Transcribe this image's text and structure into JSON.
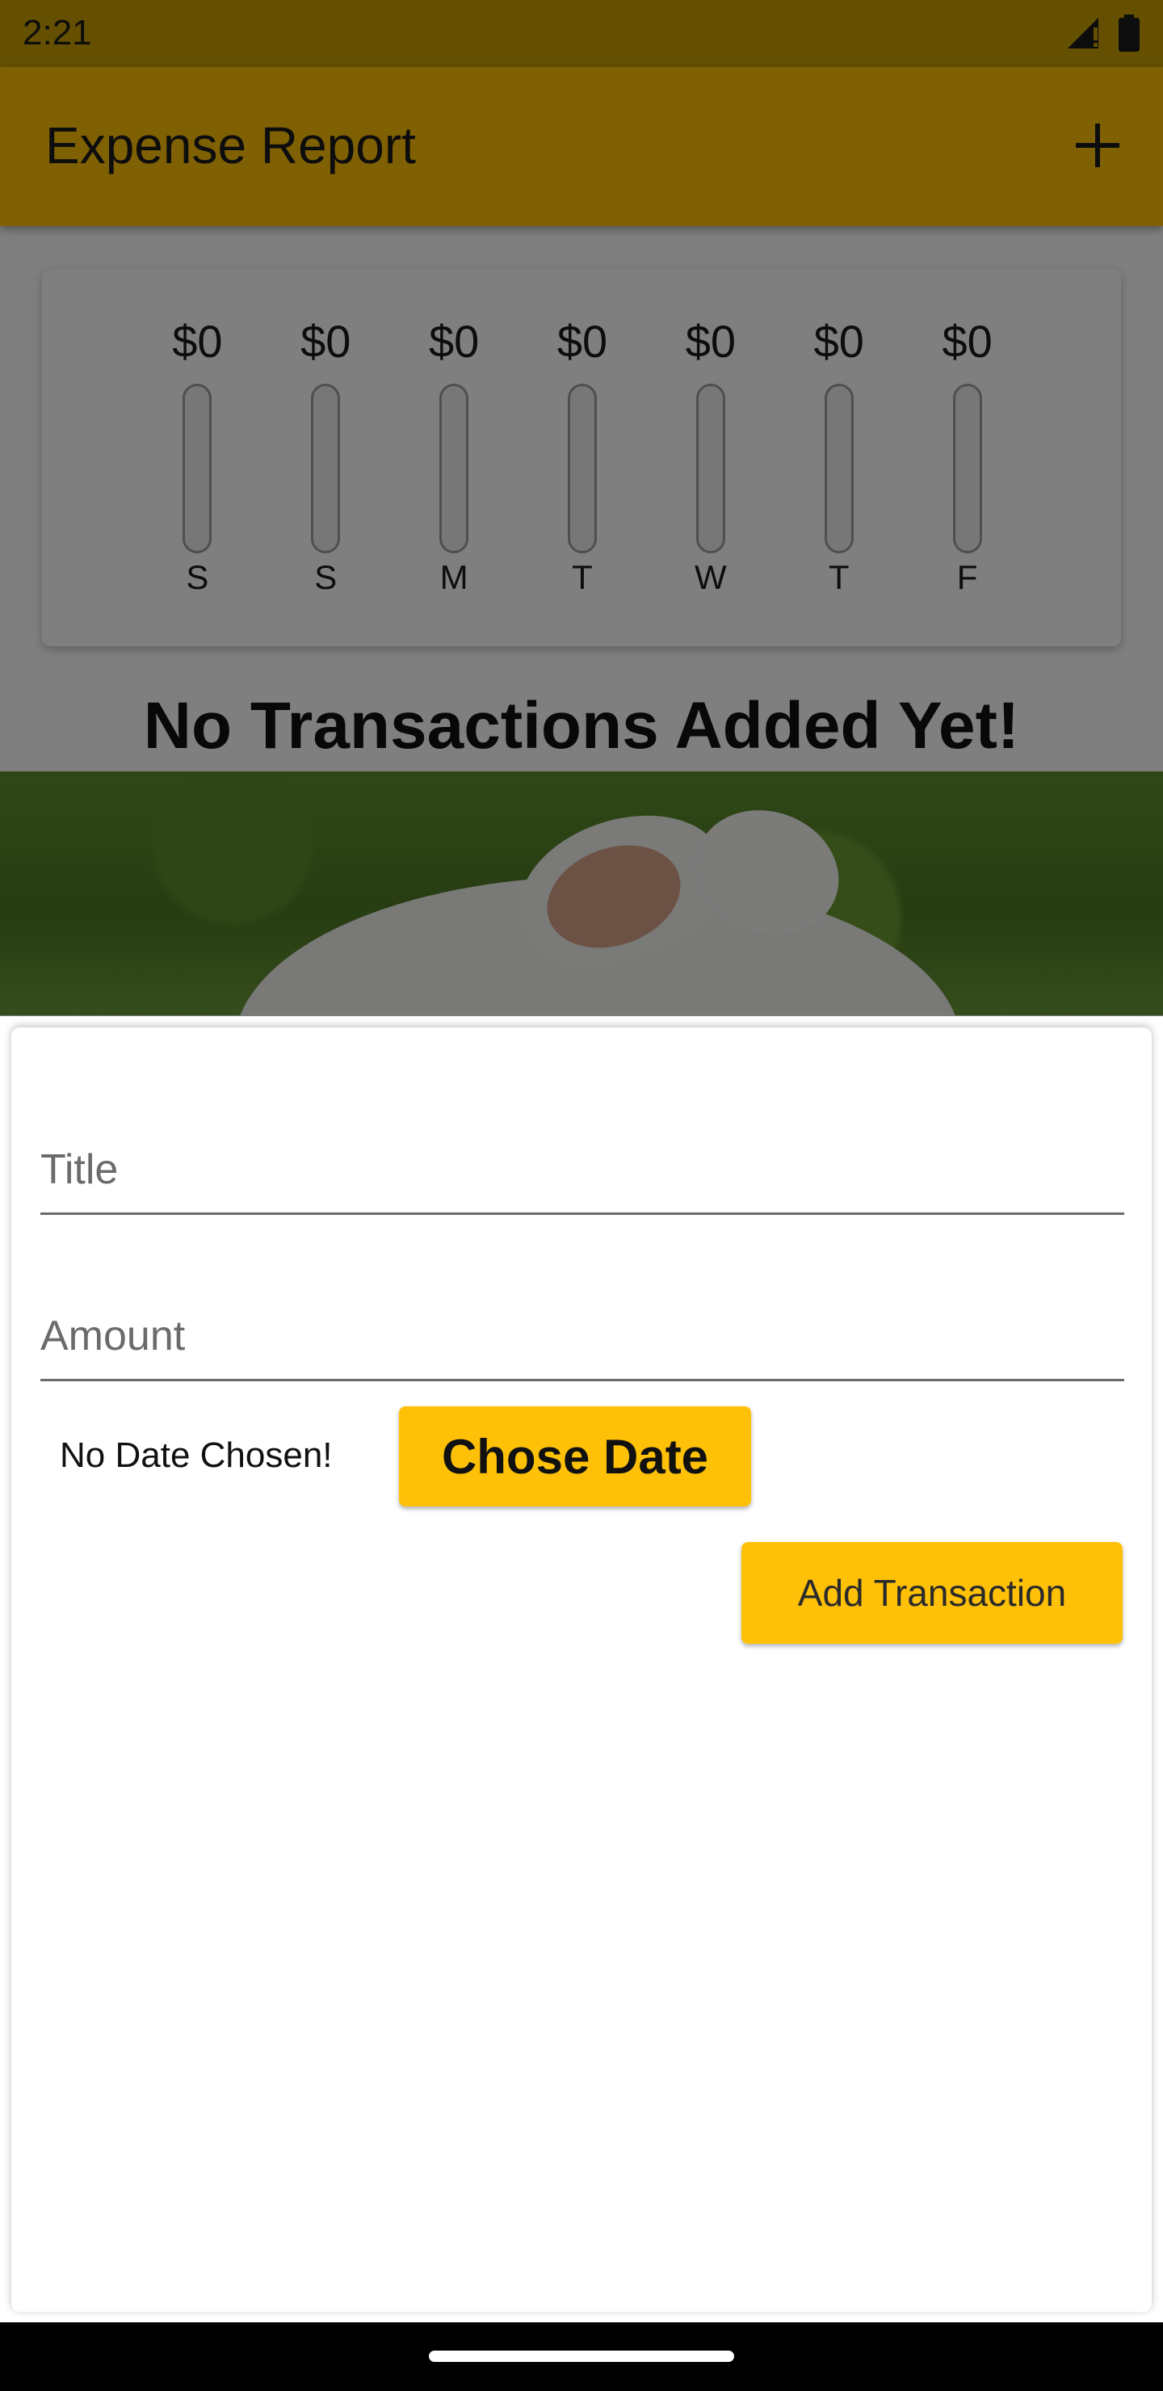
{
  "status_bar": {
    "time": "2:21"
  },
  "app_bar": {
    "title": "Expense Report",
    "add_icon": "plus-icon"
  },
  "chart_data": {
    "type": "bar",
    "categories": [
      "S",
      "S",
      "M",
      "T",
      "W",
      "T",
      "F"
    ],
    "values": [
      0,
      0,
      0,
      0,
      0,
      0,
      0
    ],
    "labels": [
      "$0",
      "$0",
      "$0",
      "$0",
      "$0",
      "$0",
      "$0"
    ],
    "ylim": [
      0,
      1
    ]
  },
  "empty_state": {
    "message": "No Transactions Added Yet!"
  },
  "form": {
    "title_placeholder": "Title",
    "amount_placeholder": "Amount",
    "date_status": "No Date Chosen!",
    "choose_date_label": "Chose Date",
    "submit_label": "Add Transaction"
  },
  "colors": {
    "primary": "#ffc107"
  }
}
